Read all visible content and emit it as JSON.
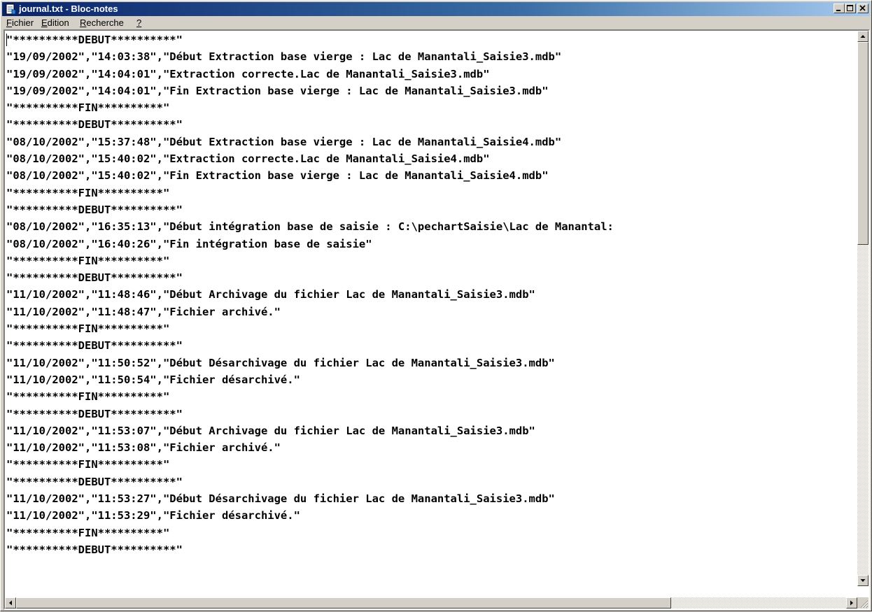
{
  "window": {
    "title": "journal.txt - Bloc-notes",
    "buttons": [
      "minimize",
      "maximize",
      "close"
    ]
  },
  "menu": [
    {
      "label": "Fichier",
      "accel": "F",
      "rest": "ichier"
    },
    {
      "label": "Edition",
      "accel": "E",
      "rest": "dition"
    },
    {
      "label": "Recherche",
      "accel": "R",
      "rest": "echerche"
    },
    {
      "label": "?",
      "accel": "?",
      "rest": ""
    }
  ],
  "editor": {
    "lines": [
      "\"**********DEBUT**********\"",
      "\"19/09/2002\",\"14:03:38\",\"Début Extraction base vierge : Lac de Manantali_Saisie3.mdb\"",
      "\"19/09/2002\",\"14:04:01\",\"Extraction correcte.Lac de Manantali_Saisie3.mdb\"",
      "\"19/09/2002\",\"14:04:01\",\"Fin Extraction base vierge : Lac de Manantali_Saisie3.mdb\"",
      "\"**********FIN**********\"",
      "\"**********DEBUT**********\"",
      "\"08/10/2002\",\"15:37:48\",\"Début Extraction base vierge : Lac de Manantali_Saisie4.mdb\"",
      "\"08/10/2002\",\"15:40:02\",\"Extraction correcte.Lac de Manantali_Saisie4.mdb\"",
      "\"08/10/2002\",\"15:40:02\",\"Fin Extraction base vierge : Lac de Manantali_Saisie4.mdb\"",
      "\"**********FIN**********\"",
      "\"**********DEBUT**********\"",
      "\"08/10/2002\",\"16:35:13\",\"Début intégration base de saisie : C:\\pechartSaisie\\Lac de Manantal:",
      "\"08/10/2002\",\"16:40:26\",\"Fin intégration base de saisie\"",
      "\"**********FIN**********\"",
      "\"**********DEBUT**********\"",
      "\"11/10/2002\",\"11:48:46\",\"Début Archivage du fichier Lac de Manantali_Saisie3.mdb\"",
      "\"11/10/2002\",\"11:48:47\",\"Fichier archivé.\"",
      "\"**********FIN**********\"",
      "\"**********DEBUT**********\"",
      "\"11/10/2002\",\"11:50:52\",\"Début Désarchivage du fichier Lac de Manantali_Saisie3.mdb\"",
      "\"11/10/2002\",\"11:50:54\",\"Fichier désarchivé.\"",
      "\"**********FIN**********\"",
      "\"**********DEBUT**********\"",
      "\"11/10/2002\",\"11:53:07\",\"Début Archivage du fichier Lac de Manantali_Saisie3.mdb\"",
      "\"11/10/2002\",\"11:53:08\",\"Fichier archivé.\"",
      "\"**********FIN**********\"",
      "\"**********DEBUT**********\"",
      "\"11/10/2002\",\"11:53:27\",\"Début Désarchivage du fichier Lac de Manantali_Saisie3.mdb\"",
      "\"11/10/2002\",\"11:53:29\",\"Fichier désarchivé.\"",
      "\"**********FIN**********\"",
      "\"**********DEBUT**********\""
    ]
  },
  "icons": {
    "app": "notepad-icon",
    "scroll_up": "arrow-up-icon",
    "scroll_down": "arrow-down-icon",
    "scroll_left": "arrow-left-icon",
    "scroll_right": "arrow-right-icon"
  },
  "colors": {
    "titlebar_start": "#0a246a",
    "titlebar_end": "#a6caf0",
    "chrome": "#d4d0c8",
    "text": "#000000"
  }
}
